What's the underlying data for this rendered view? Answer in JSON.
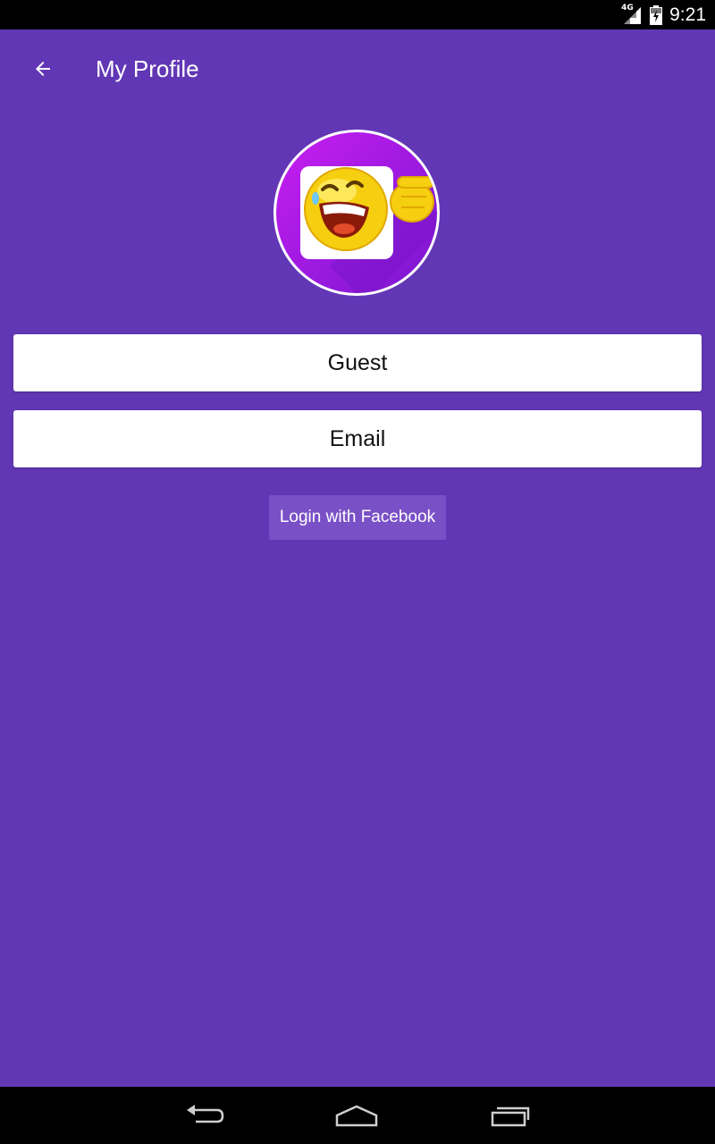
{
  "status_bar": {
    "network_label": "4G",
    "time": "9:21"
  },
  "toolbar": {
    "back_icon": "arrow-back-icon",
    "title": "My Profile"
  },
  "profile": {
    "avatar_icon": "laughing-emoji-avatar",
    "name_value": "Guest",
    "email_value": "Email",
    "login_button_label": "Login with Facebook"
  },
  "nav_bar": {
    "back_icon": "nav-back-icon",
    "home_icon": "nav-home-icon",
    "recents_icon": "nav-recents-icon"
  },
  "colors": {
    "primary": "#6237b5",
    "button": "#7a50c6",
    "avatar_background": "#b31de6",
    "emoji_yellow": "#f6cf10"
  }
}
